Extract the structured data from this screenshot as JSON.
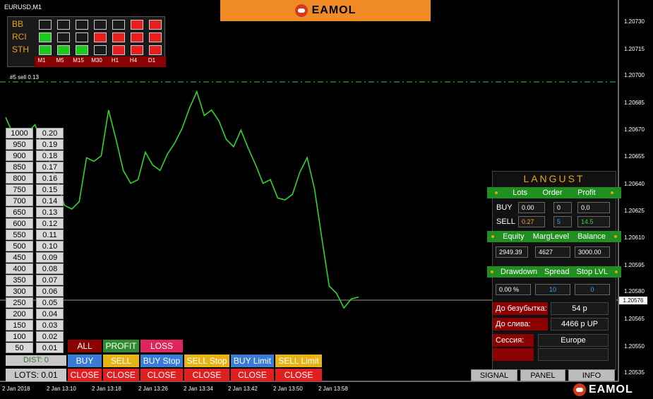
{
  "chart": {
    "symbol": "EURUSD,M1",
    "order_label": "#5 sell 0.13",
    "price_tag": "1.20576",
    "y_ticks": [
      "1.20730",
      "1.20715",
      "1.20700",
      "1.20685",
      "1.20670",
      "1.20655",
      "1.20640",
      "1.20625",
      "1.20610",
      "1.20595",
      "1.20580",
      "1.20565",
      "1.20550",
      "1.20535"
    ],
    "x_ticks": [
      "2 Jan 2018",
      "2 Jan 13:10",
      "2 Jan 13:18",
      "2 Jan 13:26",
      "2 Jan 13:34",
      "2 Jan 13:42",
      "2 Jan 13:50",
      "2 Jan 13:58"
    ],
    "line_color": "#2fd52f",
    "order_line_color": "#2fa52f"
  },
  "chart_data": {
    "type": "line",
    "series": [
      {
        "values": [
          1.20674,
          1.20665,
          1.20668,
          1.20666,
          1.2067,
          1.20658,
          1.2065,
          1.2064,
          1.20626,
          1.20624,
          1.20628,
          1.20652,
          1.2065,
          1.20653,
          1.20678,
          1.20662,
          1.20645,
          1.20638,
          1.2064,
          1.20655,
          1.20648,
          1.20645,
          1.20654,
          1.2066,
          1.20668,
          1.20679,
          1.20688,
          1.20675,
          1.20678,
          1.20672,
          1.20662,
          1.20658,
          1.20667,
          1.20657,
          1.20648,
          1.20638,
          1.2064,
          1.2063,
          1.20629,
          1.20632,
          1.20644,
          1.20652,
          1.20635,
          1.20608,
          1.20582,
          1.20578,
          1.2057,
          1.20575,
          1.20576
        ]
      }
    ],
    "ylim": [
      1.2053,
      1.20738
    ]
  },
  "brand": {
    "name": "EAMOL"
  },
  "signals": {
    "rows": [
      {
        "label": "BB",
        "cells": [
          "empty",
          "empty",
          "empty",
          "empty",
          "empty",
          "red",
          "red"
        ]
      },
      {
        "label": "RCI",
        "cells": [
          "green",
          "empty",
          "empty",
          "red",
          "red",
          "red",
          "red"
        ]
      },
      {
        "label": "STH",
        "cells": [
          "green",
          "green",
          "green",
          "empty",
          "red",
          "red",
          "red"
        ]
      }
    ],
    "timeframes": [
      "M1",
      "M5",
      "M15",
      "M30",
      "H1",
      "H4",
      "D1"
    ],
    "colors": {
      "green": "#1ec81e",
      "red": "#e61e1e",
      "empty": "#1a1a1a"
    }
  },
  "ladder": {
    "rows": [
      [
        "1000",
        "0.20"
      ],
      [
        "950",
        "0.19"
      ],
      [
        "900",
        "0.18"
      ],
      [
        "850",
        "0.17"
      ],
      [
        "800",
        "0.16"
      ],
      [
        "750",
        "0.15"
      ],
      [
        "700",
        "0.14"
      ],
      [
        "650",
        "0.13"
      ],
      [
        "600",
        "0.12"
      ],
      [
        "550",
        "0.11"
      ],
      [
        "500",
        "0.10"
      ],
      [
        "450",
        "0.09"
      ],
      [
        "400",
        "0.08"
      ],
      [
        "350",
        "0.07"
      ],
      [
        "300",
        "0.06"
      ],
      [
        "250",
        "0.05"
      ],
      [
        "200",
        "0.04"
      ],
      [
        "150",
        "0.03"
      ],
      [
        "100",
        "0.02"
      ],
      [
        "50",
        "0.01"
      ]
    ],
    "dist": "DIST: 0",
    "lots": "LOTS: 0.01"
  },
  "orders": {
    "all": "ALL",
    "profit": "PROFIT",
    "loss": "LOSS",
    "buy": "BUY",
    "sell": "SELL",
    "buy_stop": "BUY Stop",
    "sell_stop": "SELL Stop",
    "buy_limit": "BUY Limit",
    "sell_limit": "SELL Limit",
    "close": "CLOSE"
  },
  "panel": {
    "title": "LANGUST",
    "hdr1": [
      "Lots",
      "Order",
      "Profit"
    ],
    "buy_label": "BUY",
    "sell_label": "SELL",
    "buy_vals": [
      "0.00",
      "0",
      "0.0"
    ],
    "sell_vals": [
      "0.27",
      "5",
      "14.5"
    ],
    "hdr2": [
      "Equity",
      "MargLevel",
      "Balance"
    ],
    "vals2": [
      "2949.39",
      "4627",
      "3000.00"
    ],
    "hdr3": [
      "Drawdown",
      "Spread",
      "Stop LVL"
    ],
    "vals3": [
      "0.00 %",
      "10",
      "0"
    ],
    "breakeven_label": "До безубытка:",
    "breakeven_val": "54 р",
    "stopout_label": "До слива:",
    "stopout_val": "4466 p UP",
    "session_label": "Сессия:",
    "session_val": "Europe"
  },
  "toolbar": {
    "signal": "SIGNAL",
    "panel": "PANEL",
    "info": "INFO"
  }
}
